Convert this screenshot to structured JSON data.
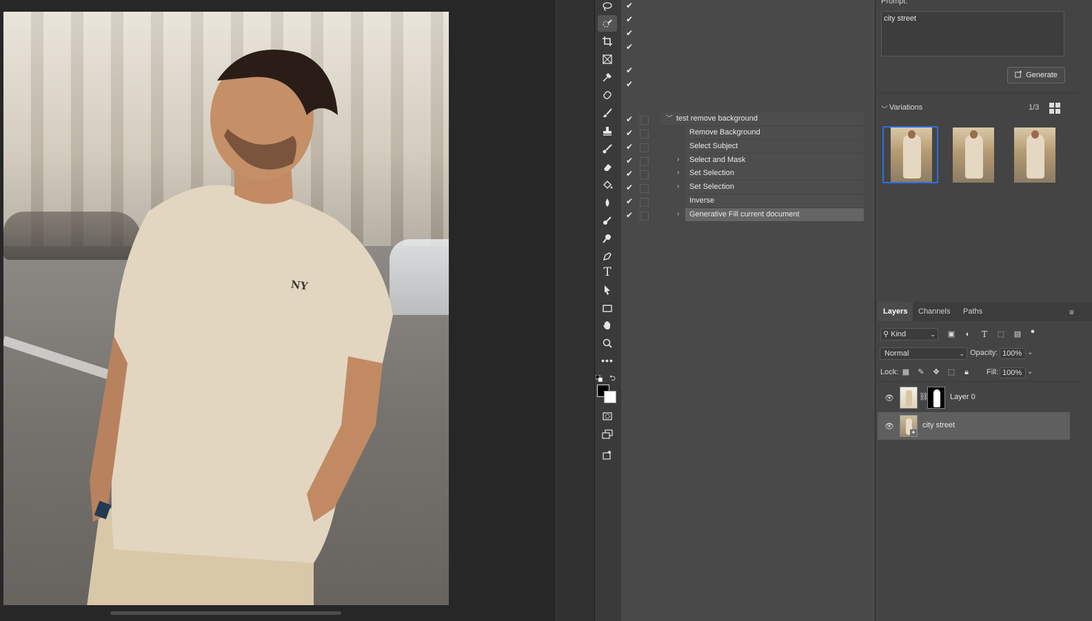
{
  "actions": {
    "set_name": "test remove background",
    "items": [
      {
        "label": "Remove Background",
        "expandable": false
      },
      {
        "label": "Select Subject",
        "expandable": false
      },
      {
        "label": "Select and Mask",
        "expandable": true
      },
      {
        "label": "Set Selection",
        "expandable": true
      },
      {
        "label": "Set Selection",
        "expandable": true
      },
      {
        "label": "Inverse",
        "expandable": false
      },
      {
        "label": "Generative Fill current document",
        "expandable": true
      }
    ]
  },
  "photo": {
    "shirt_text": "NY"
  },
  "generative": {
    "prompt_label": "Prompt:",
    "prompt_value": "city street",
    "generate_label": "Generate",
    "variations_label": "Variations",
    "variations_count": "1/3"
  },
  "layers": {
    "tabs": [
      "Layers",
      "Channels",
      "Paths"
    ],
    "kind_label": "Kind",
    "blend_mode": "Normal",
    "opacity_label": "Opacity:",
    "opacity_value": "100%",
    "lock_label": "Lock:",
    "fill_label": "Fill:",
    "fill_value": "100%",
    "items": [
      {
        "name": "Layer 0"
      },
      {
        "name": "city street"
      }
    ]
  },
  "colors": {
    "accent": "#2f6fe0",
    "panel": "#494949"
  }
}
